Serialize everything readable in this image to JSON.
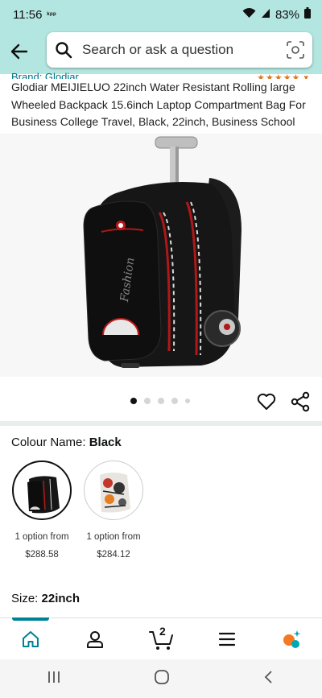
{
  "status_bar": {
    "time": "11:56",
    "carrier_icon_text": "ᵏᵖᵖ",
    "battery": "83%",
    "icons": [
      "wifi-icon",
      "signal-icon",
      "battery-icon"
    ]
  },
  "search": {
    "placeholder": "Search or ask a question",
    "icons": [
      "back-arrow-icon",
      "search-icon",
      "camera-lens-icon"
    ]
  },
  "product": {
    "brand": "Brand: Glodiar",
    "title": "Glodiar MEIJIELUO 22inch Water Resistant Rolling large Wheeled Backpack 15.6inch Laptop Compartment Bag For Business College Travel, Black, 22inch, Business School",
    "image_page_count": 5,
    "image_active_index": 0
  },
  "colour": {
    "label": "Colour Name:",
    "value": "Black",
    "options": [
      {
        "text": "1 option from",
        "price": "$288.58",
        "selected": true
      },
      {
        "text": "1 option from",
        "price": "$284.12",
        "selected": false
      }
    ]
  },
  "size": {
    "label": "Size:",
    "value": "22inch"
  },
  "bottom_nav": {
    "cart_count": "2",
    "items": [
      "home-icon",
      "account-icon",
      "cart-icon",
      "menu-icon",
      "rufus-icon"
    ]
  },
  "colors": {
    "header_bg": "#b3e6e0",
    "accent": "#008296",
    "link": "#007185"
  }
}
